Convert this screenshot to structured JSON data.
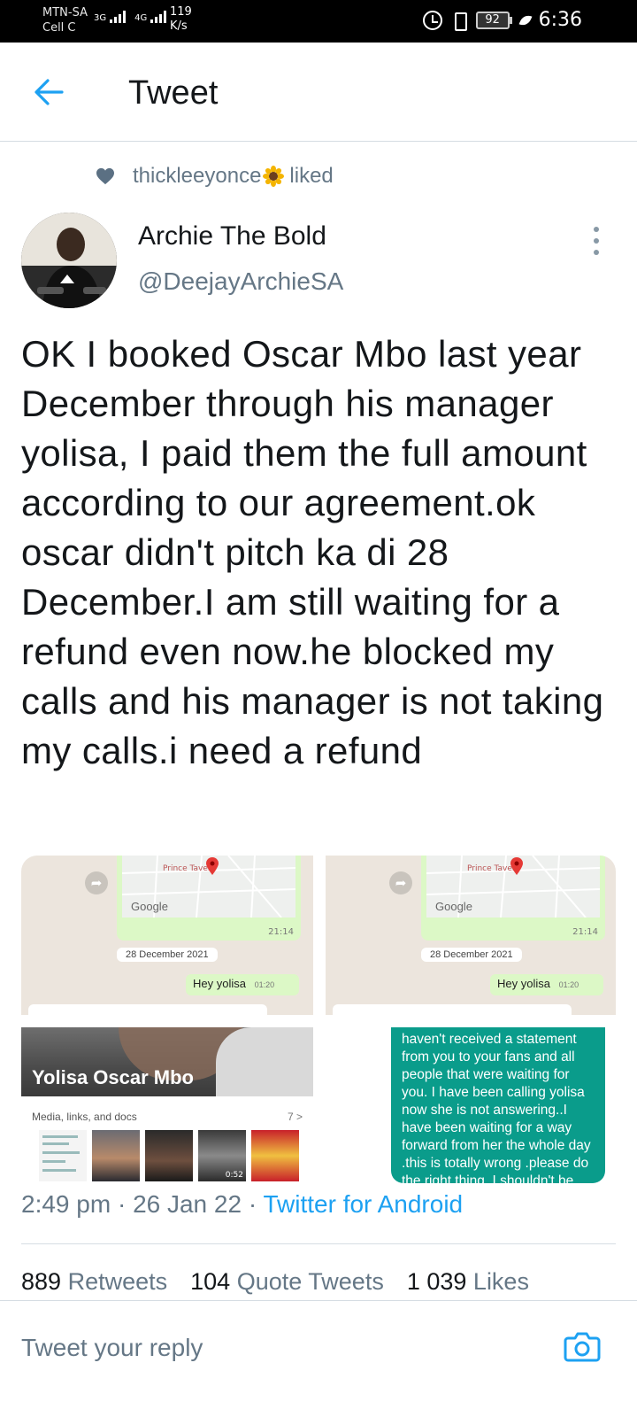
{
  "status_bar": {
    "carrier1": "MTN-SA",
    "carrier2": "Cell C",
    "net1": "3G",
    "net2": "4G",
    "speed_value": "119",
    "speed_unit": "K/s",
    "battery": "92",
    "time": "6:36"
  },
  "header": {
    "title": "Tweet"
  },
  "social_context": {
    "user": "thickleeyonce",
    "action": "liked"
  },
  "author": {
    "name": "Archie The Bold",
    "handle": "@DeejayArchieSA"
  },
  "tweet": {
    "text": "OK I booked Oscar Mbo last year December through his manager yolisa, I paid them the full amount according to our agreement.ok oscar didn't pitch ka di 28 December.I am still waiting for a refund even now.he blocked my calls and his manager is not taking my calls.i need a refund"
  },
  "media": {
    "chat": {
      "map_place": "Prince Tavern",
      "map_brand": "Google",
      "map_time": "21:14",
      "date_chip": "28 December 2021",
      "message": "Hey yolisa",
      "message_time": "01:20"
    },
    "contact": {
      "name": "Yolisa Oscar Mbo",
      "media_label": "Media, links, and docs",
      "media_count": "7 >",
      "video_duration": "0:52"
    },
    "message_text": "haven't received a statement from you to your fans and all people that were waiting for you. I have been calling yolisa now she is not answering..I have been waiting for a way forward from her the whole day .this is totally wrong .please do the right thing. I shouldn't be following"
  },
  "meta": {
    "time": "2:49 pm",
    "sep1": " · ",
    "date": "26 Jan 22",
    "sep2": " · ",
    "source": "Twitter for Android"
  },
  "stats": {
    "retweets_count": "889",
    "retweets_label": "Retweets",
    "quotes_count": "104",
    "quotes_label": "Quote Tweets",
    "likes_count": "1 039",
    "likes_label": "Likes"
  },
  "reply": {
    "placeholder": "Tweet your reply"
  },
  "colors": {
    "accent": "#1da1f2",
    "secondary_text": "#657786",
    "primary_text": "#14171a",
    "divider": "#d6dde3",
    "whatsapp_green": "#0a9c8b"
  },
  "icons": {
    "back": "arrow-left-icon",
    "like": "heart-icon",
    "more": "more-vertical-icon",
    "camera": "camera-icon"
  }
}
